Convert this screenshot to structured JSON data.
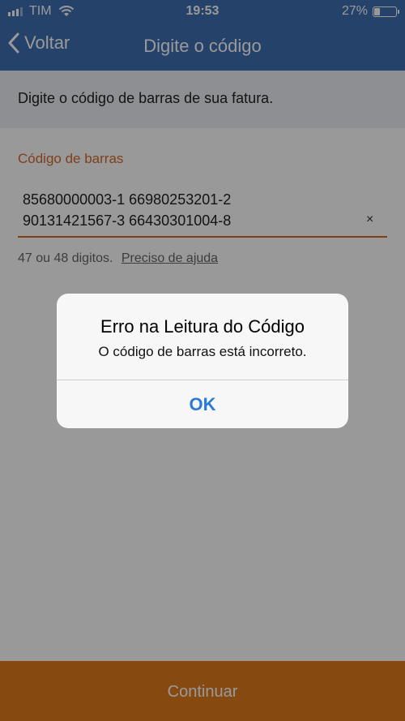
{
  "status": {
    "carrier": "TIM",
    "time": "19:53",
    "battery": "27%"
  },
  "nav": {
    "back_label": "Voltar",
    "title": "Digite o código"
  },
  "instruction": "Digite o código de barras de sua fatura.",
  "field": {
    "label": "Código de barras",
    "value_line1": "85680000003-1 66980253201-2",
    "value_line2": "90131421567-3 66430301004-8",
    "clear_icon": "×"
  },
  "hint": {
    "text": "47 ou 48 digitos.",
    "help_link": "Preciso de ajuda"
  },
  "bottom_button": "Continuar",
  "alert": {
    "title": "Erro na Leitura do Código",
    "message": "O código de barras está incorreto.",
    "ok_label": "OK"
  }
}
